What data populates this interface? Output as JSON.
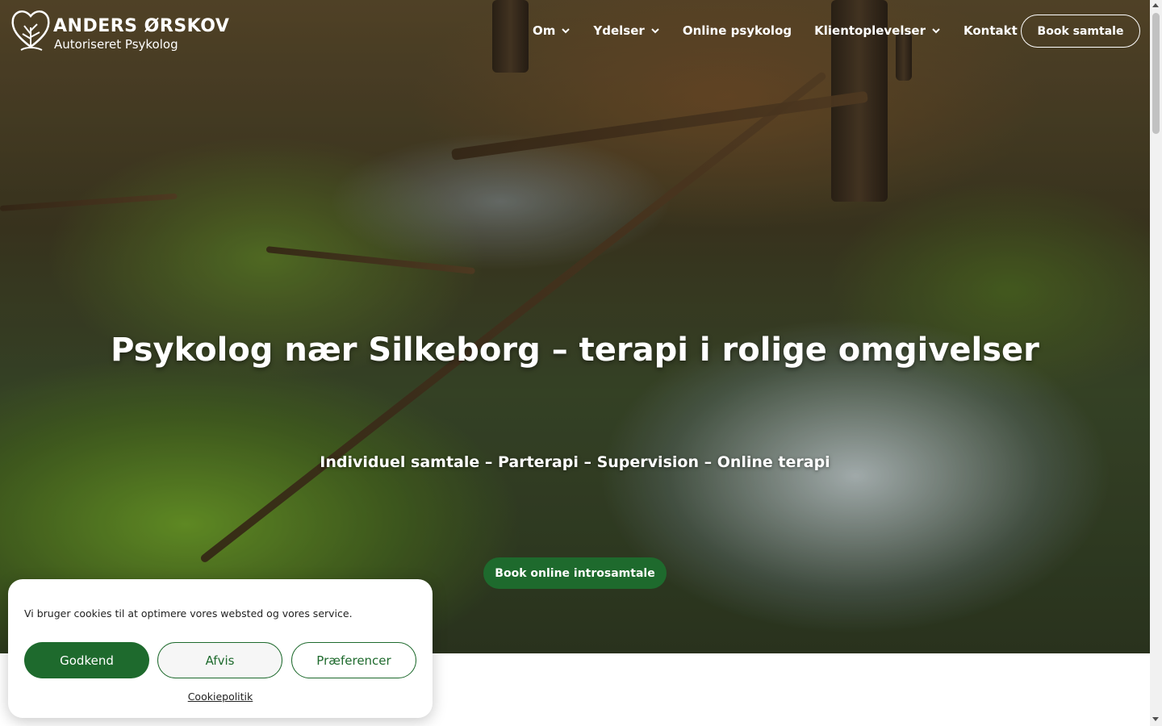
{
  "brand": {
    "name": "ANDERS ØRSKOV",
    "subtitle": "Autoriseret Psykolog"
  },
  "nav": {
    "items": [
      {
        "label": "Om",
        "dropdown": true
      },
      {
        "label": "Ydelser",
        "dropdown": true
      },
      {
        "label": "Online psykolog",
        "dropdown": false
      },
      {
        "label": "Klientoplevelser",
        "dropdown": true
      },
      {
        "label": "Kontakt",
        "dropdown": false
      }
    ],
    "cta": "Book samtale"
  },
  "hero": {
    "title": "Psykolog nær Silkeborg – terapi i rolige omgivelser",
    "subtitle": "Individuel samtale – Parterapi – Supervision – Online terapi",
    "cta": "Book online introsamtale"
  },
  "cookie": {
    "text": "Vi bruger cookies til at optimere vores websted og vores service.",
    "accept": "Godkend",
    "reject": "Afvis",
    "preferences": "Præferencer",
    "policy_link": "Cookiepolitik"
  },
  "colors": {
    "primary_green": "#1e6a2d",
    "white": "#ffffff"
  },
  "icons": {
    "logo": "tree-heart-icon",
    "dropdown": "chevron-down-icon"
  }
}
